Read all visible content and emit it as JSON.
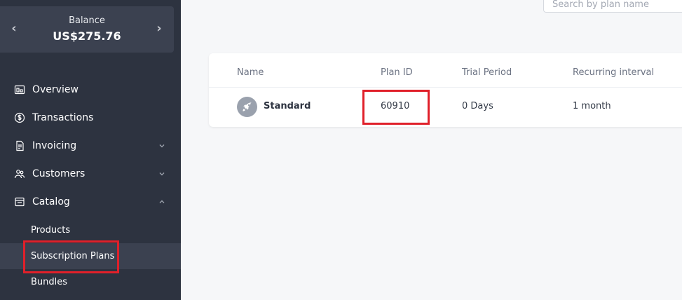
{
  "sidebar": {
    "balance": {
      "label": "Balance",
      "value": "US$275.76",
      "prev_arrow": "‹",
      "next_arrow": "›"
    },
    "nav": [
      {
        "label": "Overview",
        "icon": "overview-icon"
      },
      {
        "label": "Transactions",
        "icon": "dollar-circle-icon"
      },
      {
        "label": "Invoicing",
        "icon": "invoice-icon",
        "chevron": "down"
      },
      {
        "label": "Customers",
        "icon": "users-icon",
        "chevron": "down"
      },
      {
        "label": "Catalog",
        "icon": "catalog-icon",
        "chevron": "up"
      }
    ],
    "catalog_items": [
      {
        "label": "Products"
      },
      {
        "label": "Subscription Plans",
        "active": true
      },
      {
        "label": "Bundles"
      }
    ]
  },
  "search": {
    "placeholder": "Search by plan name"
  },
  "table": {
    "columns": [
      "Name",
      "Plan ID",
      "Trial Period",
      "Recurring interval"
    ],
    "rows": [
      {
        "icon": "rocket-icon",
        "name": "Standard",
        "plan_id": "60910",
        "trial_period": "0 Days",
        "recurring_interval": "1 month"
      }
    ]
  },
  "colors": {
    "sidebar_bg": "#2d3340",
    "highlight": "#e0202a",
    "page_bg": "#f6f7f9"
  }
}
